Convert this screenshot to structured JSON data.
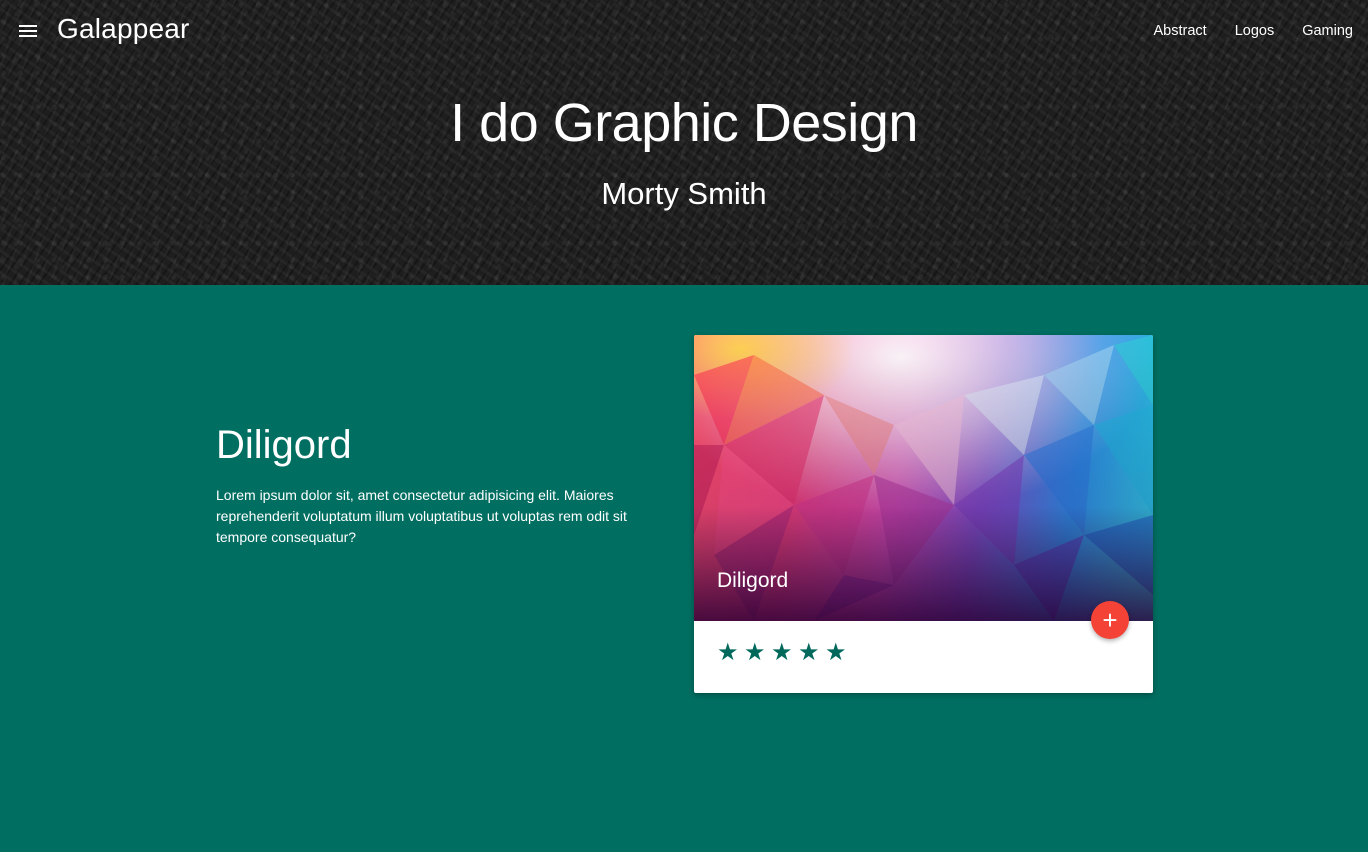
{
  "header": {
    "brand": "Galappear",
    "nav": [
      "Abstract",
      "Logos",
      "Gaming"
    ],
    "menu_icon": "menu-icon",
    "title": "I do Graphic Design",
    "subtitle": "Morty Smith"
  },
  "main": {
    "heading": "Diligord",
    "description": "Lorem ipsum dolor sit, amet consectetur adipisicing elit. Maiores reprehenderit voluptatum illum voluptatibus ut voluptas rem odit sit tempore consequatur?",
    "card": {
      "title": "Diligord",
      "fab_icon": "plus-icon",
      "rating": 5,
      "rating_max": 5
    }
  },
  "colors": {
    "teal": "#006e61",
    "header_bg": "#1e1e1e",
    "fab": "#f44336",
    "star": "#00695c"
  }
}
